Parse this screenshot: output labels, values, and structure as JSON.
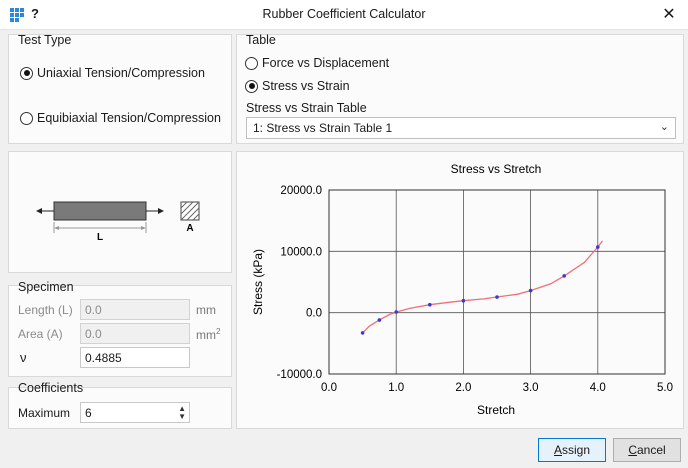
{
  "window": {
    "help": "?",
    "title": "Rubber Coefficient Calculator",
    "close": "✕"
  },
  "test_type": {
    "title": "Test Type",
    "options": [
      {
        "label": "Uniaxial Tension/Compression",
        "checked": true
      },
      {
        "label": "Equibiaxial Tension/Compression",
        "checked": false
      }
    ]
  },
  "table": {
    "title": "Table",
    "options": [
      {
        "label": "Force vs Displacement",
        "checked": false
      },
      {
        "label": "Stress vs Strain",
        "checked": true
      }
    ],
    "select_label": "Stress vs Strain Table",
    "select_value": "1: Stress vs Strain Table 1"
  },
  "diagram": {
    "length_label": "L",
    "area_label": "A"
  },
  "specimen": {
    "title": "Specimen",
    "length_label": "Length (L)",
    "length_value": "0.0",
    "length_unit": "mm",
    "area_label": "Area (A)",
    "area_value": "0.0",
    "area_unit": "mm",
    "area_unit_sup": "2",
    "nu_label": "ν",
    "nu_value": "0.4885"
  },
  "coefficients": {
    "title": "Coefficients",
    "maximum_label": "Maximum",
    "maximum_value": "6"
  },
  "buttons": {
    "assign_prefix": "",
    "assign_ul": "A",
    "assign_rest": "ssign",
    "cancel_prefix": "",
    "cancel_ul": "C",
    "cancel_rest": "ancel"
  },
  "chart_data": {
    "type": "line",
    "title": "Stress vs Stretch",
    "xlabel": "Stretch",
    "ylabel": "Stress (kPa)",
    "xlim": [
      0.0,
      5.0
    ],
    "ylim": [
      -10000.0,
      20000.0
    ],
    "x_ticks": [
      "0.0",
      "1.0",
      "2.0",
      "3.0",
      "4.0",
      "5.0"
    ],
    "y_ticks": [
      "-10000.0",
      "0.0",
      "10000.0",
      "20000.0"
    ],
    "grid": true,
    "colors": {
      "curve": "#f06f7a",
      "points": "#3a3ad0"
    },
    "curve": {
      "x": [
        0.5,
        0.6,
        0.75,
        0.9,
        1.0,
        1.2,
        1.5,
        1.8,
        2.0,
        2.3,
        2.5,
        2.8,
        3.0,
        3.3,
        3.5,
        3.8,
        4.0,
        4.07
      ],
      "y": [
        -3300,
        -2200,
        -1200,
        -300,
        100,
        700,
        1300,
        1700,
        1950,
        2250,
        2550,
        3000,
        3600,
        4700,
        6000,
        8200,
        10700,
        11700
      ]
    },
    "points": {
      "x": [
        0.5,
        0.75,
        1.0,
        1.5,
        2.0,
        2.5,
        3.0,
        3.5,
        4.0
      ],
      "y": [
        -3300,
        -1200,
        100,
        1300,
        1950,
        2550,
        3600,
        6000,
        10700
      ]
    }
  }
}
